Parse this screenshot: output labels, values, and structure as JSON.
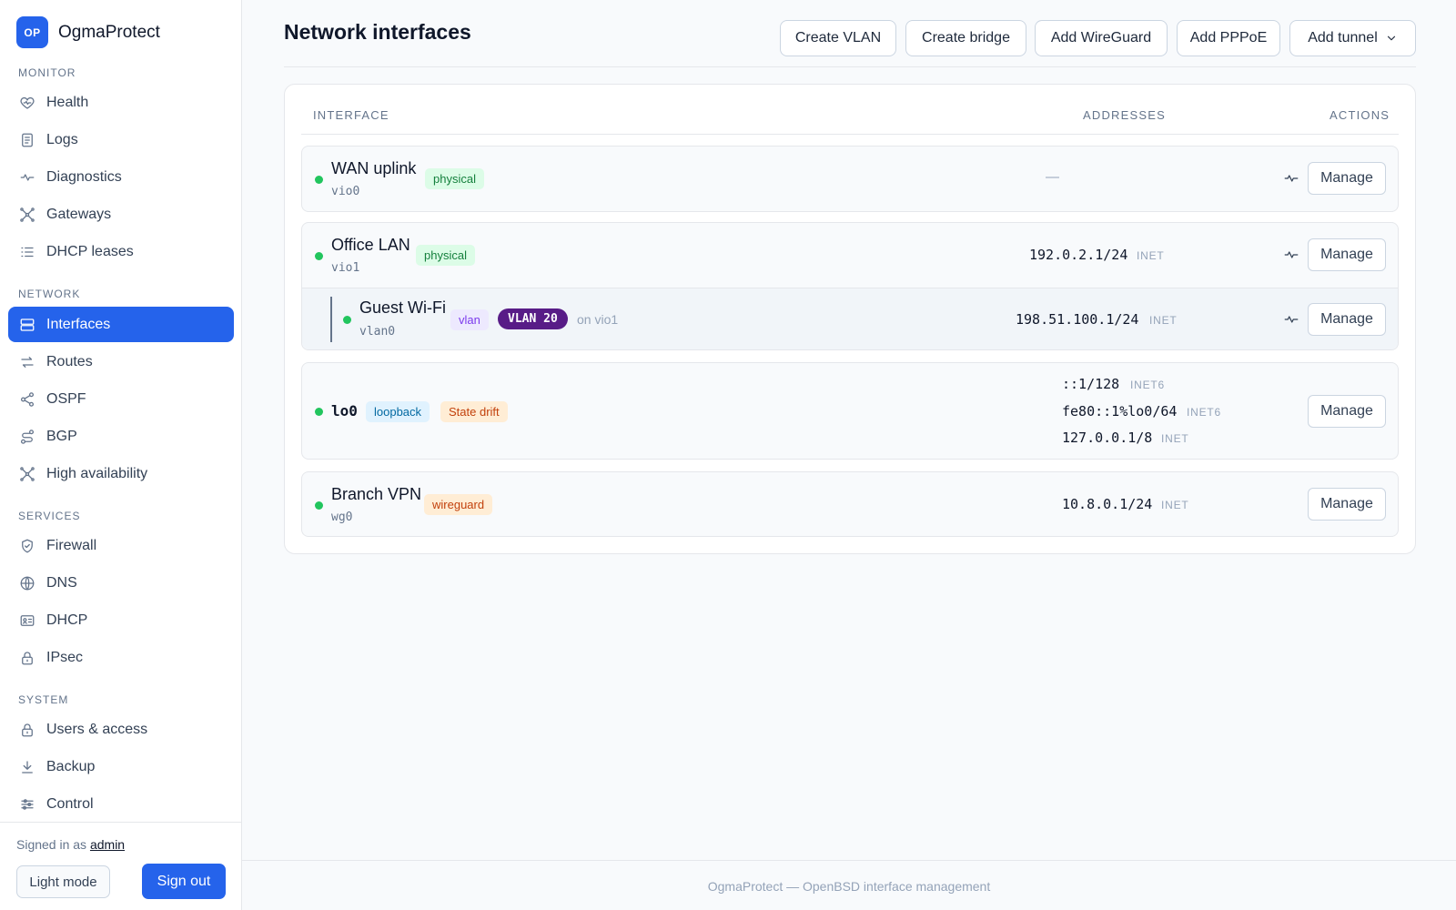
{
  "brand": {
    "logo": "OP",
    "name": "OgmaProtect"
  },
  "sidebar": {
    "sections": [
      {
        "title": "MONITOR",
        "items": [
          {
            "label": "Health",
            "icon": "heart-icon"
          },
          {
            "label": "Logs",
            "icon": "document-icon"
          },
          {
            "label": "Diagnostics",
            "icon": "pulse-icon"
          },
          {
            "label": "Gateways",
            "icon": "network-nodes-icon"
          },
          {
            "label": "DHCP leases",
            "icon": "list-icon"
          }
        ]
      },
      {
        "title": "NETWORK",
        "items": [
          {
            "label": "Interfaces",
            "icon": "interfaces-icon",
            "active": true
          },
          {
            "label": "Routes",
            "icon": "arrows-icon"
          },
          {
            "label": "OSPF",
            "icon": "share-icon"
          },
          {
            "label": "BGP",
            "icon": "route-icon"
          },
          {
            "label": "High availability",
            "icon": "network-nodes-icon"
          }
        ]
      },
      {
        "title": "SERVICES",
        "items": [
          {
            "label": "Firewall",
            "icon": "shield-icon"
          },
          {
            "label": "DNS",
            "icon": "globe-icon"
          },
          {
            "label": "DHCP",
            "icon": "id-card-icon"
          },
          {
            "label": "IPsec",
            "icon": "lock-icon"
          }
        ]
      },
      {
        "title": "SYSTEM",
        "items": [
          {
            "label": "Users & access",
            "icon": "lock-icon"
          },
          {
            "label": "Backup",
            "icon": "download-icon"
          },
          {
            "label": "Control",
            "icon": "sliders-icon"
          }
        ]
      }
    ],
    "footer": {
      "signed_prefix": "Signed in as",
      "user": "admin",
      "light_mode": "Light mode",
      "sign_out": "Sign out"
    }
  },
  "header": {
    "title": "Network interfaces",
    "buttons": {
      "create_vlan": "Create VLAN",
      "create_bridge": "Create bridge",
      "add_wireguard": "Add WireGuard",
      "add_pppoe": "Add PPPoE",
      "add_tunnel": "Add tunnel"
    }
  },
  "table": {
    "columns": {
      "interface": "INTERFACE",
      "addresses": "ADDRESSES",
      "actions": "ACTIONS"
    },
    "manage_label": "Manage",
    "no_address": "—",
    "rows": {
      "wan": {
        "name": "WAN uplink",
        "device": "vio0",
        "badge": "physical"
      },
      "lan": {
        "name": "Office LAN",
        "device": "vio1",
        "badge": "physical",
        "address": "192.0.2.1/24",
        "family": "INET"
      },
      "guest": {
        "name": "Guest Wi-Fi",
        "device": "vlan0",
        "badge": "vlan",
        "vlan_id": "VLAN 20",
        "parent": "on vio1",
        "address": "198.51.100.1/24",
        "family": "INET"
      },
      "lo": {
        "name": "lo0",
        "badges": [
          "loopback",
          "State drift"
        ],
        "addresses": [
          {
            "address": "::1/128",
            "family": "INET6"
          },
          {
            "address": "fe80::1%lo0/64",
            "family": "INET6"
          },
          {
            "address": "127.0.0.1/8",
            "family": "INET"
          }
        ]
      },
      "branch": {
        "name": "Branch VPN",
        "device": "wg0",
        "badge": "wireguard",
        "address": "10.8.0.1/24",
        "family": "INET"
      }
    }
  },
  "footer": {
    "text": "OgmaProtect — OpenBSD interface management"
  },
  "colors": {
    "accent": "#2563eb",
    "status_up": "#22c55e",
    "vlan_tag": "#581c87"
  }
}
